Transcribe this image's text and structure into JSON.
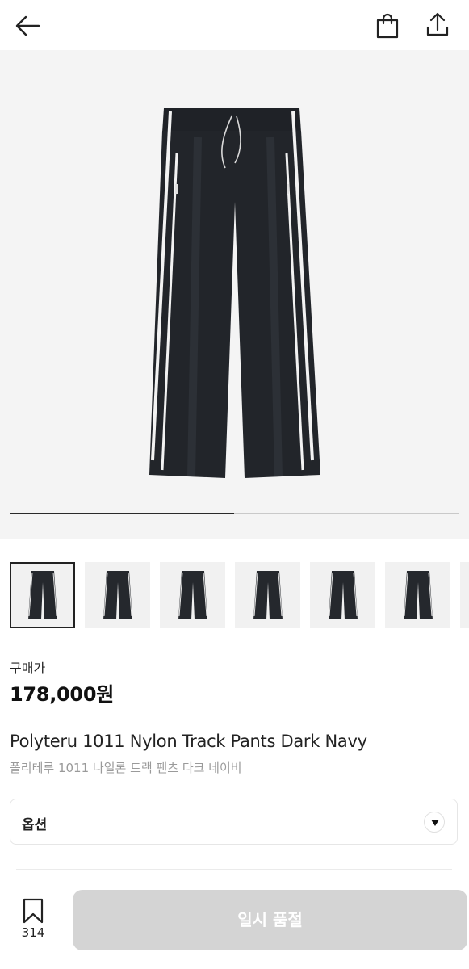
{
  "header": {
    "back_icon": "arrow-left-icon",
    "bag_icon": "shopping-bag-icon",
    "share_icon": "share-upload-icon"
  },
  "gallery": {
    "progress_fraction": 0.5,
    "thumbnails": [
      {
        "active": true
      },
      {
        "active": false
      },
      {
        "active": false
      },
      {
        "active": false
      },
      {
        "active": false
      },
      {
        "active": false
      },
      {
        "active": false
      }
    ]
  },
  "product": {
    "price_label": "구매가",
    "price": "178,000원",
    "title_en": "Polyteru 1011 Nylon Track Pants Dark Navy",
    "title_ko": "폴리테루 1011 나일론 트랙 팬츠 다크 네이비"
  },
  "options": {
    "label": "옵션"
  },
  "bottom_bar": {
    "bookmark_count": "314",
    "soldout_label": "일시 품절"
  },
  "colors": {
    "accent_text": "#111111",
    "soldout_bg": "#d4d4d4",
    "hero_bg": "#f4f4f4"
  }
}
